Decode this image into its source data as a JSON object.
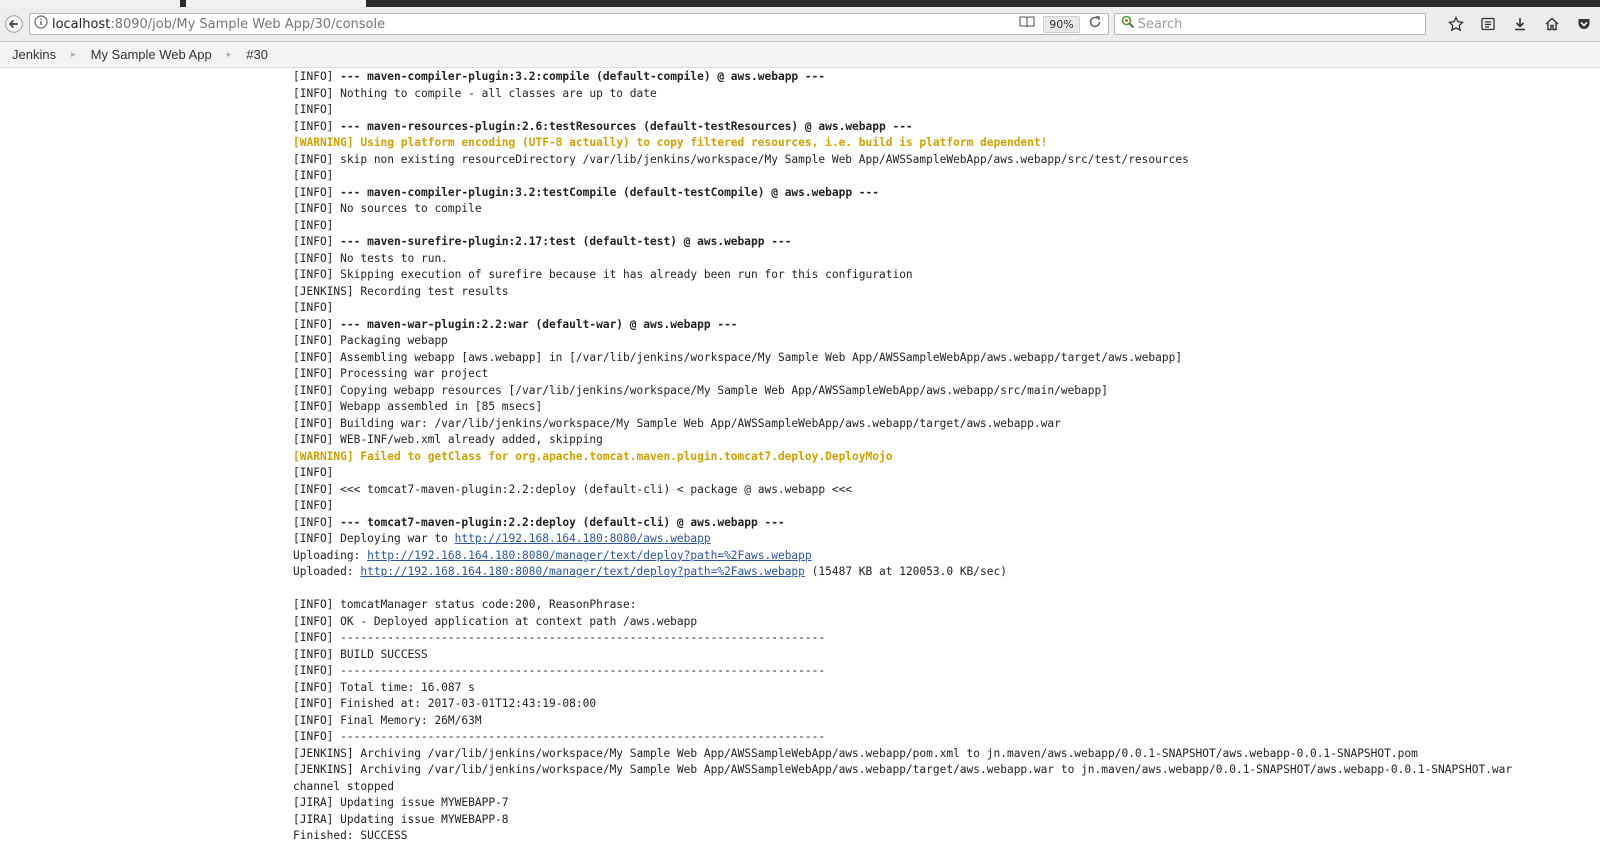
{
  "browser": {
    "url_host": "localhost",
    "url_path": ":8090/job/My Sample Web App/30/console",
    "zoom": "90%",
    "search_placeholder": "Search"
  },
  "breadcrumbs": [
    "Jenkins",
    "My Sample Web App",
    "#30"
  ],
  "console": {
    "lines": [
      {
        "text": "[INFO] ",
        "bold": "--- maven-compiler-plugin:3.2:compile (default-compile) @ aws.webapp ---"
      },
      {
        "text": "[INFO] Nothing to compile - all classes are up to date"
      },
      {
        "text": "[INFO]"
      },
      {
        "text": "[INFO] ",
        "bold": "--- maven-resources-plugin:2.6:testResources (default-testResources) @ aws.webapp ---"
      },
      {
        "warn": "[WARNING] Using platform encoding (UTF-8 actually) to copy filtered resources, i.e. build is platform dependent!"
      },
      {
        "text": "[INFO] skip non existing resourceDirectory /var/lib/jenkins/workspace/My Sample Web App/AWSSampleWebApp/aws.webapp/src/test/resources"
      },
      {
        "text": "[INFO]"
      },
      {
        "text": "[INFO] ",
        "bold": "--- maven-compiler-plugin:3.2:testCompile (default-testCompile) @ aws.webapp ---"
      },
      {
        "text": "[INFO] No sources to compile"
      },
      {
        "text": "[INFO]"
      },
      {
        "text": "[INFO] ",
        "bold": "--- maven-surefire-plugin:2.17:test (default-test) @ aws.webapp ---"
      },
      {
        "text": "[INFO] No tests to run."
      },
      {
        "text": "[INFO] Skipping execution of surefire because it has already been run for this configuration"
      },
      {
        "text": "[JENKINS] Recording test results"
      },
      {
        "text": "[INFO]"
      },
      {
        "text": "[INFO] ",
        "bold": "--- maven-war-plugin:2.2:war (default-war) @ aws.webapp ---"
      },
      {
        "text": "[INFO] Packaging webapp"
      },
      {
        "text": "[INFO] Assembling webapp [aws.webapp] in [/var/lib/jenkins/workspace/My Sample Web App/AWSSampleWebApp/aws.webapp/target/aws.webapp]"
      },
      {
        "text": "[INFO] Processing war project"
      },
      {
        "text": "[INFO] Copying webapp resources [/var/lib/jenkins/workspace/My Sample Web App/AWSSampleWebApp/aws.webapp/src/main/webapp]"
      },
      {
        "text": "[INFO] Webapp assembled in [85 msecs]"
      },
      {
        "text": "[INFO] Building war: /var/lib/jenkins/workspace/My Sample Web App/AWSSampleWebApp/aws.webapp/target/aws.webapp.war"
      },
      {
        "text": "[INFO] WEB-INF/web.xml already added, skipping"
      },
      {
        "warn": "[WARNING] Failed to getClass for org.apache.tomcat.maven.plugin.tomcat7.deploy.DeployMojo"
      },
      {
        "text": "[INFO]"
      },
      {
        "text": "[INFO] <<< tomcat7-maven-plugin:2.2:deploy (default-cli) < package @ aws.webapp <<<"
      },
      {
        "text": "[INFO]"
      },
      {
        "text": "[INFO] ",
        "bold": "--- tomcat7-maven-plugin:2.2:deploy (default-cli) @ aws.webapp ---"
      },
      {
        "text": "[INFO] Deploying war to ",
        "link": "http://192.168.164.180:8080/aws.webapp"
      },
      {
        "text": "Uploading: ",
        "link": "http://192.168.164.180:8080/manager/text/deploy?path=%2Faws.webapp"
      },
      {
        "text": "Uploaded: ",
        "link": "http://192.168.164.180:8080/manager/text/deploy?path=%2Faws.webapp",
        "after": " (15487 KB at 120053.0 KB/sec)"
      },
      {
        "text": ""
      },
      {
        "text": "[INFO] tomcatManager status code:200, ReasonPhrase:"
      },
      {
        "text": "[INFO] OK - Deployed application at context path /aws.webapp"
      },
      {
        "text": "[INFO] ------------------------------------------------------------------------"
      },
      {
        "text": "[INFO] BUILD SUCCESS"
      },
      {
        "text": "[INFO] ------------------------------------------------------------------------"
      },
      {
        "text": "[INFO] Total time: 16.087 s"
      },
      {
        "text": "[INFO] Finished at: 2017-03-01T12:43:19-08:00"
      },
      {
        "text": "[INFO] Final Memory: 26M/63M"
      },
      {
        "text": "[INFO] ------------------------------------------------------------------------"
      },
      {
        "text": "[JENKINS] Archiving /var/lib/jenkins/workspace/My Sample Web App/AWSSampleWebApp/aws.webapp/pom.xml to jn.maven/aws.webapp/0.0.1-SNAPSHOT/aws.webapp-0.0.1-SNAPSHOT.pom"
      },
      {
        "text": "[JENKINS] Archiving /var/lib/jenkins/workspace/My Sample Web App/AWSSampleWebApp/aws.webapp/target/aws.webapp.war to jn.maven/aws.webapp/0.0.1-SNAPSHOT/aws.webapp-0.0.1-SNAPSHOT.war"
      },
      {
        "text": "channel stopped"
      },
      {
        "text": "[JIRA] Updating issue MYWEBAPP-7"
      },
      {
        "text": "[JIRA] Updating issue MYWEBAPP-8"
      },
      {
        "text": "Finished: SUCCESS"
      }
    ]
  }
}
